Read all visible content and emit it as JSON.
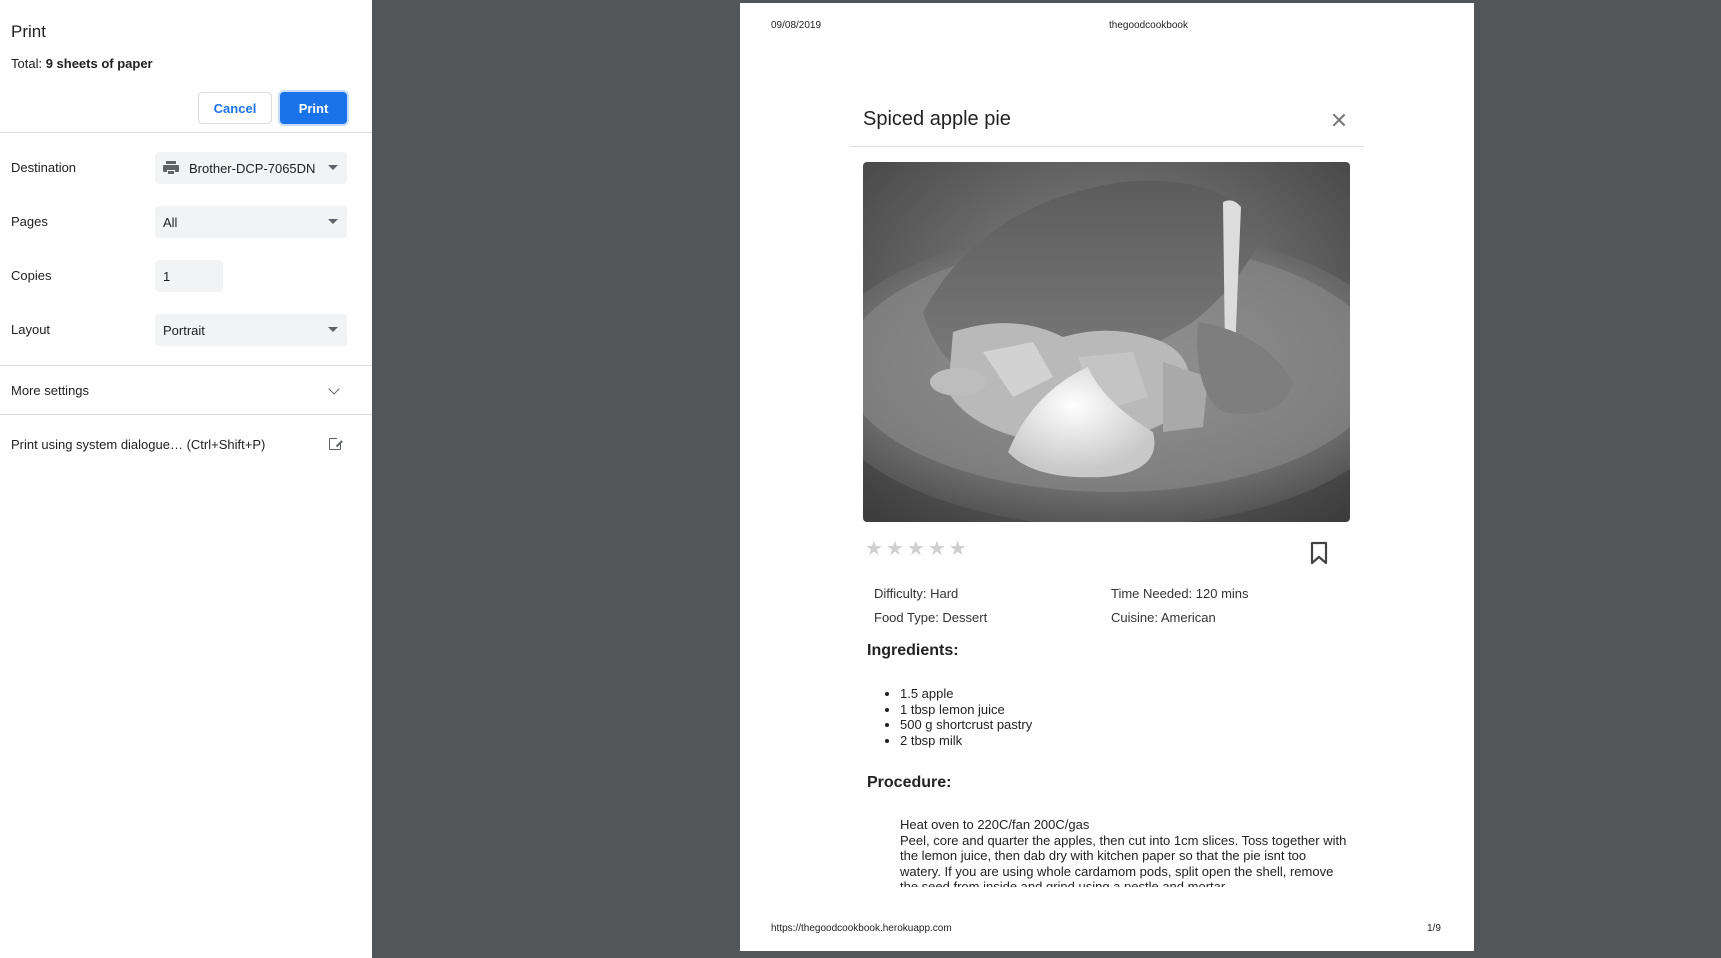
{
  "dialog": {
    "title": "Print",
    "total_label": "Total: ",
    "total_value": "9 sheets of paper",
    "cancel_label": "Cancel",
    "print_label": "Print",
    "destination_label": "Destination",
    "destination_value": "Brother-DCP-7065DN",
    "pages_label": "Pages",
    "pages_value": "All",
    "copies_label": "Copies",
    "copies_value": "1",
    "layout_label": "Layout",
    "layout_value": "Portrait",
    "more_settings_label": "More settings",
    "system_dialog_label": "Print using system dialogue… (Ctrl+Shift+P)"
  },
  "preview": {
    "header_date": "09/08/2019",
    "header_site": "thegoodcookbook",
    "footer_url": "https://thegoodcookbook.herokuapp.com",
    "footer_page": "1/9",
    "recipe": {
      "title": "Spiced apple pie",
      "rating": 0,
      "rating_max": 5,
      "difficulty": "Difficulty: Hard",
      "time_needed": "Time Needed: 120 mins",
      "food_type": "Food Type: Dessert",
      "cuisine": "Cuisine: American",
      "ingredients_heading": "Ingredients:",
      "ingredients": [
        "1.5 apple",
        "1 tbsp lemon juice",
        "500 g shortcrust pastry",
        "2 tbsp milk"
      ],
      "procedure_heading": "Procedure:",
      "procedure": [
        "Heat oven to 220C/fan 200C/gas",
        "Peel, core and quarter the apples, then cut into 1cm slices. Toss together with the lemon juice, then dab dry with kitchen paper so that the pie isnt too watery. If you are using whole cardamom pods, split open the shell, remove the seed from inside and grind using a pestle and mortar."
      ]
    }
  }
}
